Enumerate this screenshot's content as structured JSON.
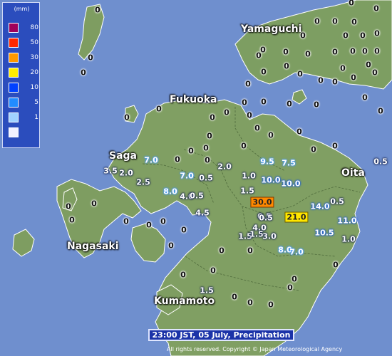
{
  "legend": {
    "unit": "(mm)",
    "levels": [
      {
        "label": "80",
        "color": "#a0005a"
      },
      {
        "label": "50",
        "color": "#ff2800"
      },
      {
        "label": "30",
        "color": "#ff9900"
      },
      {
        "label": "20",
        "color": "#ffee00"
      },
      {
        "label": "10",
        "color": "#0041ff"
      },
      {
        "label": "5",
        "color": "#218cff"
      },
      {
        "label": "1",
        "color": "#a0d2ff"
      },
      {
        "label": "",
        "color": "#f2f2ff"
      }
    ]
  },
  "places": {
    "yamaguchi": "Yamaguchi",
    "fukuoka": "Fukuoka",
    "saga": "Saga",
    "oita": "Oita",
    "nagasaki": "Nagasaki",
    "kumamoto": "Kumamoto"
  },
  "caption": "23:00 JST, 05 July, Precipitation",
  "copyright": "All rights reserved. Copyright © Japan Meteorological Agency",
  "observations": [
    {
      "v": "9.5",
      "c": "lblue"
    },
    {
      "v": "7.5",
      "c": "lblue"
    },
    {
      "v": "7.0",
      "c": "lblue"
    },
    {
      "v": "7.0",
      "c": "lblue"
    },
    {
      "v": "8.0",
      "c": "lblue"
    },
    {
      "v": "8.0",
      "c": "lblue"
    },
    {
      "v": "7.0",
      "c": "lblue"
    },
    {
      "v": "10.0",
      "c": "blue"
    },
    {
      "v": "10.0",
      "c": "blue"
    },
    {
      "v": "14.0",
      "c": "blue"
    },
    {
      "v": "11.0",
      "c": "blue"
    },
    {
      "v": "10.5",
      "c": "blue"
    },
    {
      "v": "30.0",
      "c": "orange"
    },
    {
      "v": "21.0",
      "c": "yellow"
    },
    {
      "v": "3.5",
      "c": "dark"
    },
    {
      "v": "2.0",
      "c": "dark"
    },
    {
      "v": "2.5",
      "c": "dark"
    },
    {
      "v": "2.0",
      "c": "dark"
    },
    {
      "v": "1.0",
      "c": "dark"
    },
    {
      "v": "1.5",
      "c": "dark"
    },
    {
      "v": "4.0",
      "c": "dark"
    },
    {
      "v": "0.5",
      "c": "dark"
    },
    {
      "v": "0.5",
      "c": "dark"
    },
    {
      "v": "4.5",
      "c": "dark"
    },
    {
      "v": "0.5",
      "c": "dark"
    },
    {
      "v": "4.0",
      "c": "dark"
    },
    {
      "v": "1.5",
      "c": "dark"
    },
    {
      "v": "1.5",
      "c": "dark"
    },
    {
      "v": "3.0",
      "c": "dark"
    },
    {
      "v": "0.5",
      "c": "dark"
    },
    {
      "v": "0.5",
      "c": "dark"
    },
    {
      "v": "1.0",
      "c": "dark"
    },
    {
      "v": "1.5",
      "c": "dark"
    },
    {
      "v": "0.5",
      "c": "dark"
    },
    {
      "v": "0",
      "c": "z"
    },
    {
      "v": "0",
      "c": "z"
    },
    {
      "v": "0",
      "c": "z"
    },
    {
      "v": "0",
      "c": "z"
    },
    {
      "v": "0",
      "c": "z"
    },
    {
      "v": "0",
      "c": "z"
    },
    {
      "v": "0",
      "c": "z"
    },
    {
      "v": "0",
      "c": "z"
    },
    {
      "v": "0",
      "c": "z"
    },
    {
      "v": "0",
      "c": "z"
    },
    {
      "v": "0",
      "c": "z"
    },
    {
      "v": "0",
      "c": "z"
    },
    {
      "v": "0",
      "c": "z"
    },
    {
      "v": "0",
      "c": "z"
    },
    {
      "v": "0",
      "c": "z"
    },
    {
      "v": "0",
      "c": "z"
    },
    {
      "v": "0",
      "c": "z"
    },
    {
      "v": "0",
      "c": "z"
    },
    {
      "v": "0",
      "c": "z"
    },
    {
      "v": "0",
      "c": "z"
    },
    {
      "v": "0",
      "c": "z"
    },
    {
      "v": "0",
      "c": "z"
    },
    {
      "v": "0",
      "c": "z"
    },
    {
      "v": "0",
      "c": "z"
    },
    {
      "v": "0",
      "c": "z"
    },
    {
      "v": "0",
      "c": "z"
    },
    {
      "v": "0",
      "c": "z"
    },
    {
      "v": "0",
      "c": "z"
    },
    {
      "v": "0",
      "c": "z"
    },
    {
      "v": "0",
      "c": "z"
    },
    {
      "v": "0",
      "c": "z"
    },
    {
      "v": "0",
      "c": "z"
    },
    {
      "v": "0",
      "c": "z"
    },
    {
      "v": "0",
      "c": "z"
    },
    {
      "v": "0",
      "c": "z"
    },
    {
      "v": "0",
      "c": "z"
    },
    {
      "v": "0",
      "c": "z"
    },
    {
      "v": "0",
      "c": "z"
    },
    {
      "v": "0",
      "c": "z"
    },
    {
      "v": "0",
      "c": "z"
    },
    {
      "v": "0",
      "c": "z"
    },
    {
      "v": "0",
      "c": "z"
    },
    {
      "v": "0",
      "c": "z"
    },
    {
      "v": "0",
      "c": "z"
    },
    {
      "v": "0",
      "c": "z"
    },
    {
      "v": "0",
      "c": "z"
    },
    {
      "v": "0",
      "c": "z"
    },
    {
      "v": "0",
      "c": "z"
    },
    {
      "v": "0",
      "c": "z"
    },
    {
      "v": "0",
      "c": "z"
    },
    {
      "v": "0",
      "c": "z"
    },
    {
      "v": "0",
      "c": "z"
    },
    {
      "v": "0",
      "c": "z"
    },
    {
      "v": "0",
      "c": "z"
    },
    {
      "v": "0",
      "c": "z"
    },
    {
      "v": "0",
      "c": "z"
    },
    {
      "v": "0",
      "c": "z"
    },
    {
      "v": "0",
      "c": "z"
    },
    {
      "v": "0",
      "c": "z"
    },
    {
      "v": "0",
      "c": "z"
    },
    {
      "v": "0",
      "c": "z"
    },
    {
      "v": "0",
      "c": "z"
    },
    {
      "v": "0",
      "c": "z"
    },
    {
      "v": "0",
      "c": "z"
    },
    {
      "v": "0",
      "c": "z"
    },
    {
      "v": "0",
      "c": "z"
    },
    {
      "v": "0",
      "c": "z"
    },
    {
      "v": "0",
      "c": "z"
    },
    {
      "v": "0",
      "c": "z"
    },
    {
      "v": "0",
      "c": "z"
    },
    {
      "v": "0",
      "c": "z"
    },
    {
      "v": "0",
      "c": "z"
    },
    {
      "v": "0",
      "c": "z"
    },
    {
      "v": "0",
      "c": "z"
    },
    {
      "v": "0",
      "c": "z"
    },
    {
      "v": "0",
      "c": "z"
    },
    {
      "v": "0",
      "c": "z"
    },
    {
      "v": "0",
      "c": "z"
    },
    {
      "v": "0",
      "c": "z"
    },
    {
      "v": "0",
      "c": "z"
    }
  ]
}
